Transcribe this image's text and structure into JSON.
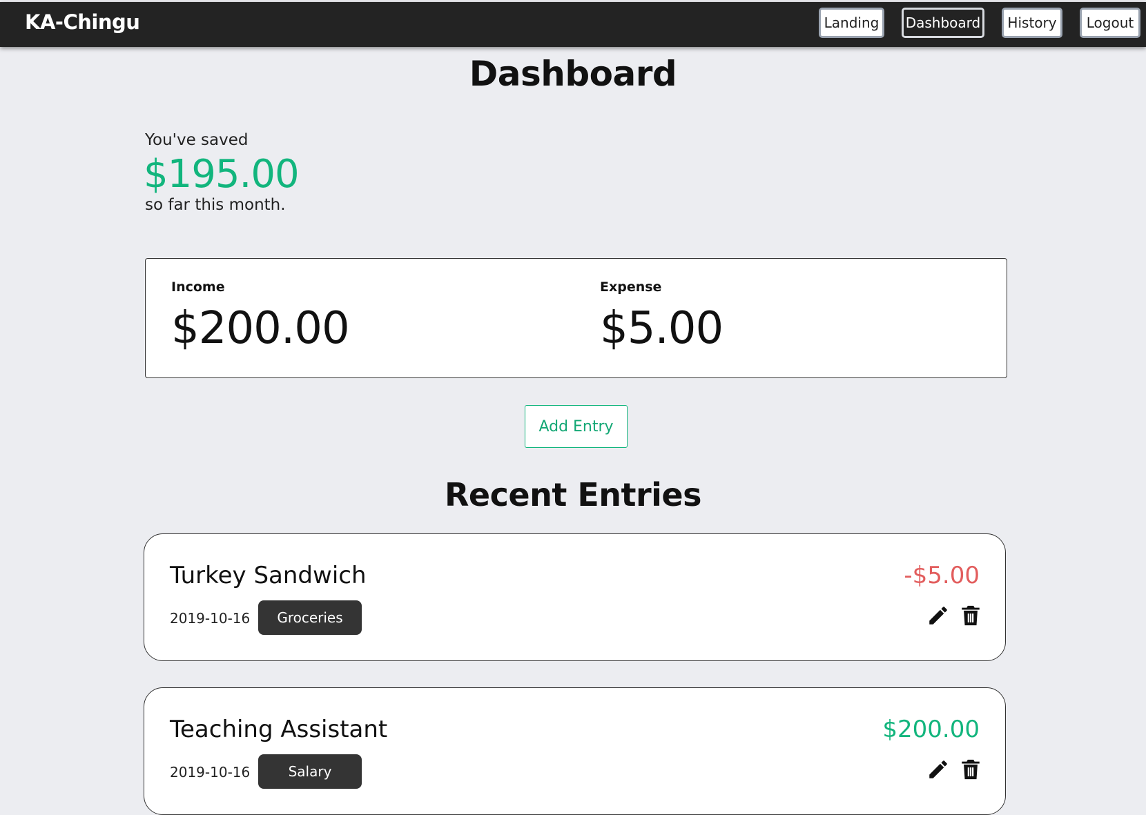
{
  "app": {
    "brand": "KA-Chingu"
  },
  "nav": {
    "items": [
      {
        "label": "Landing",
        "active": false
      },
      {
        "label": "Dashboard",
        "active": true
      },
      {
        "label": "History",
        "active": false
      },
      {
        "label": "Logout",
        "active": false
      }
    ]
  },
  "page": {
    "title": "Dashboard"
  },
  "savings": {
    "prefix": "You've saved",
    "amount": "$195.00",
    "suffix": "so far this month.",
    "amount_color": "#12b57d"
  },
  "summary": {
    "income_label": "Income",
    "income_value": "$200.00",
    "expense_label": "Expense",
    "expense_value": "$5.00"
  },
  "actions": {
    "add_entry_label": "Add Entry"
  },
  "recent": {
    "title": "Recent Entries",
    "entries": [
      {
        "title": "Turkey Sandwich",
        "amount": "-$5.00",
        "amount_type": "expense",
        "date": "2019-10-16",
        "category": "Groceries",
        "icons": [
          "pencil-icon",
          "trash-icon"
        ]
      },
      {
        "title": "Teaching Assistant",
        "amount": "$200.00",
        "amount_type": "income",
        "date": "2019-10-16",
        "category": "Salary",
        "icons": [
          "pencil-icon",
          "trash-icon"
        ]
      }
    ]
  },
  "colors": {
    "navbar": "#232323",
    "background": "#ecedf1",
    "positive": "#12b57d",
    "negative": "#e25d5d",
    "tag": "#343434"
  }
}
